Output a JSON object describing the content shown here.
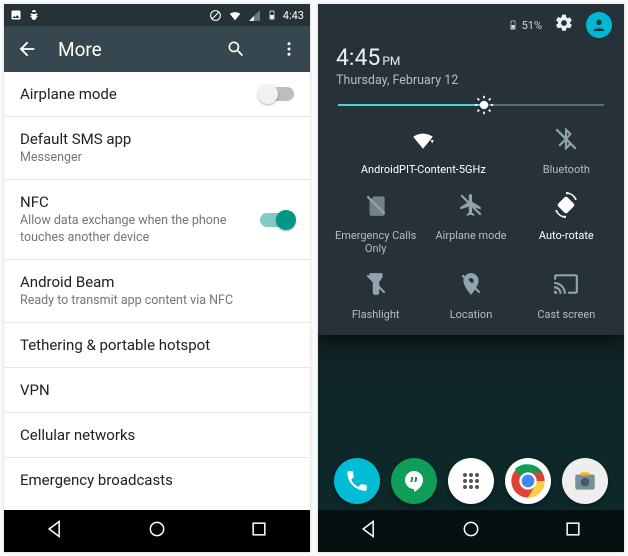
{
  "left": {
    "status_time": "4:43",
    "title": "More",
    "items": [
      {
        "primary": "Airplane mode",
        "secondary": null,
        "switch": "off"
      },
      {
        "primary": "Default SMS app",
        "secondary": "Messenger",
        "switch": null
      },
      {
        "primary": "NFC",
        "secondary": "Allow data exchange when the phone touches another device",
        "switch": "on"
      },
      {
        "primary": "Android Beam",
        "secondary": "Ready to transmit app content via NFC",
        "switch": null
      },
      {
        "primary": "Tethering & portable hotspot",
        "secondary": null,
        "switch": null
      },
      {
        "primary": "VPN",
        "secondary": null,
        "switch": null
      },
      {
        "primary": "Cellular networks",
        "secondary": null,
        "switch": null
      },
      {
        "primary": "Emergency broadcasts",
        "secondary": null,
        "switch": null
      }
    ]
  },
  "right": {
    "battery_pct": "51%",
    "clock": "4:45",
    "ampm": "PM",
    "date": "Thursday, February 12",
    "brightness_pct": 55,
    "tiles": [
      {
        "label": "AndroidPIT-Content-5GHz",
        "icon": "wifi",
        "active": true
      },
      {
        "label": "Bluetooth",
        "icon": "bluetooth-off",
        "active": false
      },
      {
        "label": "Emergency Calls Only",
        "icon": "no-sim",
        "active": false
      },
      {
        "label": "Airplane mode",
        "icon": "airplane-off",
        "active": false
      },
      {
        "label": "Auto-rotate",
        "icon": "auto-rotate",
        "active": true
      },
      {
        "label": "Flashlight",
        "icon": "flashlight-off",
        "active": false
      },
      {
        "label": "Location",
        "icon": "location-off",
        "active": false
      },
      {
        "label": "Cast screen",
        "icon": "cast",
        "active": false
      }
    ],
    "dock_apps": [
      "phone",
      "hangouts",
      "apps",
      "chrome",
      "camera"
    ]
  },
  "colors": {
    "teal": "#009688",
    "shade_bg": "#263238",
    "cyan": "#00b8d4"
  }
}
